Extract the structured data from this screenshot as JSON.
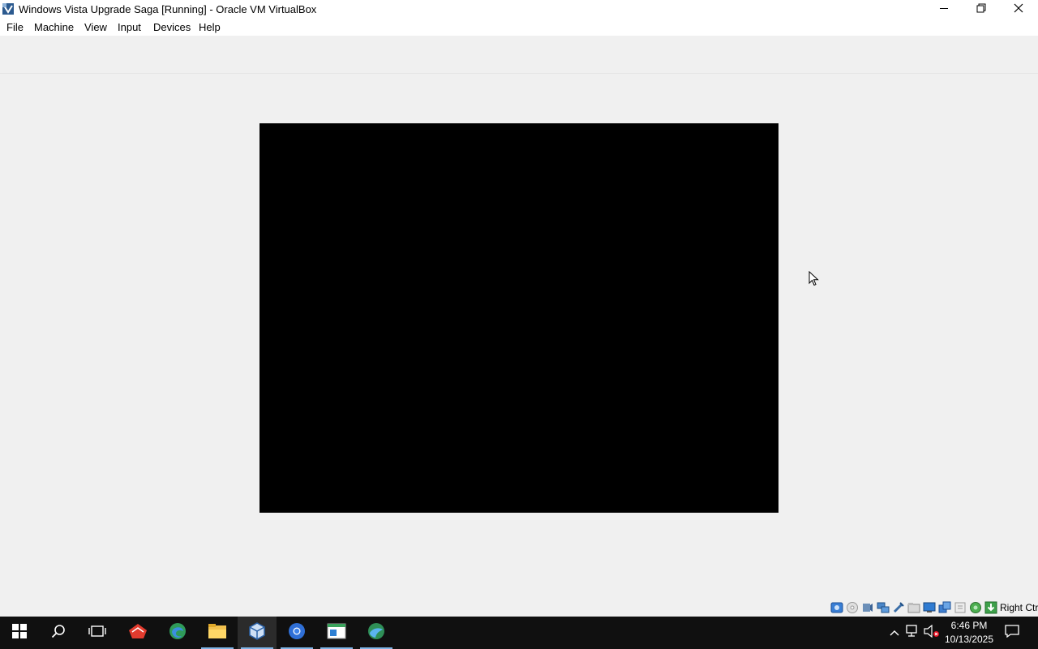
{
  "window": {
    "title": "Windows Vista Upgrade Saga [Running] - Oracle VM VirtualBox",
    "controls": [
      "minimize-icon",
      "restore-icon",
      "close-icon"
    ]
  },
  "menubar": {
    "items": [
      {
        "label": "File"
      },
      {
        "label": "Machine"
      },
      {
        "label": "View"
      },
      {
        "label": "Input"
      },
      {
        "label": "Devices"
      },
      {
        "label": "Help"
      }
    ]
  },
  "statusbar": {
    "icons": [
      "hard-disk-icon",
      "optical-drive-icon",
      "audio-icon",
      "network-icon",
      "usb-icon",
      "shared-folders-icon",
      "display-icon",
      "recording-icon",
      "mouse-integration-icon",
      "cpu-icon",
      "arrow-indicator-icon"
    ],
    "host_key": "Right Ctrl"
  },
  "taskbar": {
    "apps": [
      "start-icon",
      "search-icon",
      "task-view-icon",
      "app-red-icon",
      "edge-icon",
      "file-explorer-icon",
      "virtualbox-icon",
      "chrome-icon",
      "app-window-icon",
      "app-globe-icon"
    ],
    "clock": {
      "time": "6:46 PM",
      "date": "10/13/2025"
    }
  },
  "colors": {
    "accent": "#7fb4e6",
    "taskbar": "#101010",
    "vm_screen": "#000000"
  }
}
